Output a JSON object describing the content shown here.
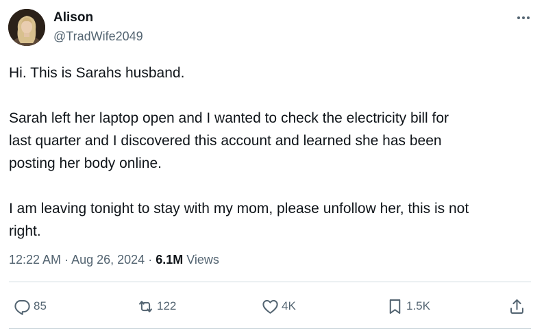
{
  "author": {
    "name": "Alison",
    "handle": "@TradWife2049"
  },
  "tweet": {
    "paragraphs": [
      "Hi. This is Sarahs husband.",
      "Sarah left her laptop open and I wanted to check the electricity bill for\nlast quarter and I discovered this account and learned she has been\nposting her body online.",
      "I am leaving tonight to stay with my mom, please unfollow her, this is not\nright."
    ]
  },
  "meta": {
    "time": "12:22 AM",
    "separator1": " · ",
    "date": "Aug 26, 2024",
    "separator2": " · ",
    "views_count": "6.1M",
    "views_label": " Views"
  },
  "actions": {
    "replies": "85",
    "reposts": "122",
    "likes": "4K",
    "bookmarks": "1.5K"
  },
  "icons": {
    "more": "more-horizontal-icon",
    "reply": "reply-icon",
    "repost": "repost-icon",
    "like": "heart-icon",
    "bookmark": "bookmark-icon",
    "share": "share-icon"
  },
  "colors": {
    "text_primary": "#0f1419",
    "text_secondary": "#536471",
    "divider": "#cfd9de"
  }
}
